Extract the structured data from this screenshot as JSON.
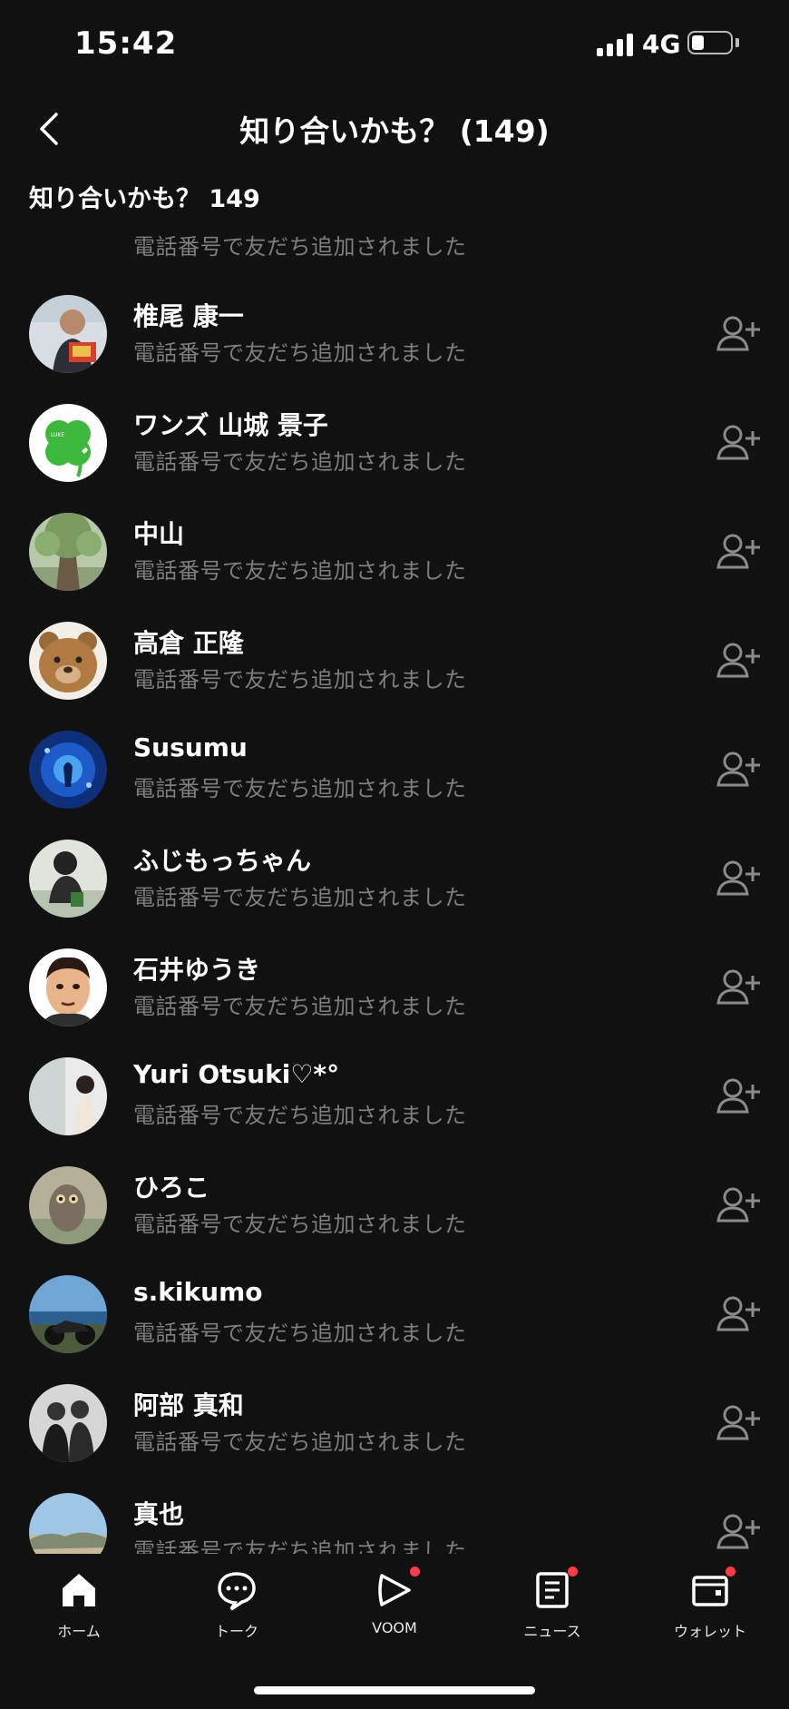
{
  "status_bar": {
    "time": "15:42",
    "network": "4G"
  },
  "header": {
    "title": "知り合いかも？ (149)"
  },
  "section": {
    "title": "知り合いかも？ 149"
  },
  "partial_top_row": {
    "subtitle": "電話番号で友だち追加されました"
  },
  "contacts": [
    {
      "name": "椎尾 康一",
      "subtitle": "電話番号で友だち追加されました"
    },
    {
      "name": "ワンズ 山城 景子",
      "subtitle": "電話番号で友だち追加されました"
    },
    {
      "name": "中山",
      "subtitle": "電話番号で友だち追加されました"
    },
    {
      "name": "高倉 正隆",
      "subtitle": "電話番号で友だち追加されました"
    },
    {
      "name": "Susumu",
      "subtitle": "電話番号で友だち追加されました"
    },
    {
      "name": "ふじもっちゃん",
      "subtitle": "電話番号で友だち追加されました"
    },
    {
      "name": "石井ゆうき",
      "subtitle": "電話番号で友だち追加されました"
    },
    {
      "name": "Yuri Otsuki♡*°",
      "subtitle": "電話番号で友だち追加されました"
    },
    {
      "name": "ひろこ",
      "subtitle": "電話番号で友だち追加されました"
    },
    {
      "name": "s.kikumo",
      "subtitle": "電話番号で友だち追加されました"
    },
    {
      "name": "阿部 真和",
      "subtitle": "電話番号で友だち追加されました"
    },
    {
      "name": "真也",
      "subtitle": "電話番号で友だち追加されました"
    }
  ],
  "tabs": [
    {
      "label": "ホーム",
      "icon": "home-icon",
      "badge": false
    },
    {
      "label": "トーク",
      "icon": "chat-icon",
      "badge": false
    },
    {
      "label": "VOOM",
      "icon": "voom-icon",
      "badge": true
    },
    {
      "label": "ニュース",
      "icon": "news-icon",
      "badge": true
    },
    {
      "label": "ウォレット",
      "icon": "wallet-icon",
      "badge": true
    }
  ],
  "colors": {
    "background": "#111111",
    "subtext": "#7e7e7e",
    "badge": "#ff3b4a"
  }
}
